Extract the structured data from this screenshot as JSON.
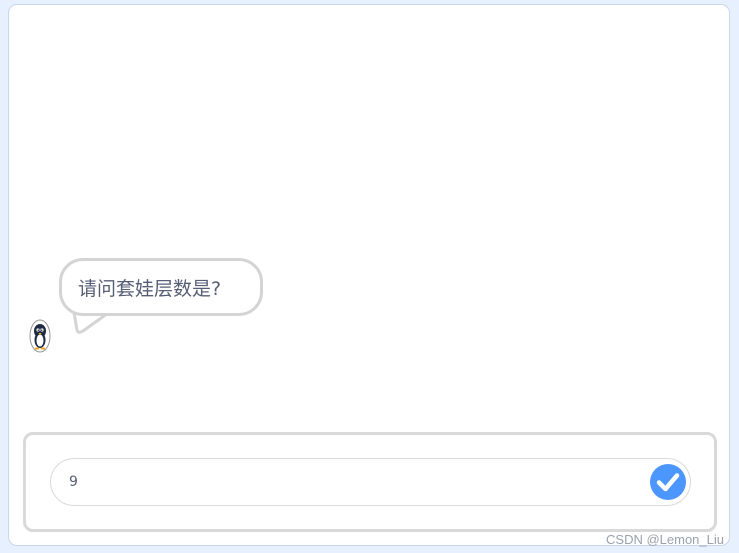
{
  "stage": {
    "sprite": {
      "icon": "penguin-icon"
    },
    "speech_bubble": {
      "text": "请问套娃层数是?"
    }
  },
  "ask_prompt": {
    "answer_value": "9",
    "submit_icon": "checkmark-icon",
    "accent_color": "#4c97ff"
  },
  "watermark": {
    "text": "CSDN @Lemon_Liu"
  }
}
